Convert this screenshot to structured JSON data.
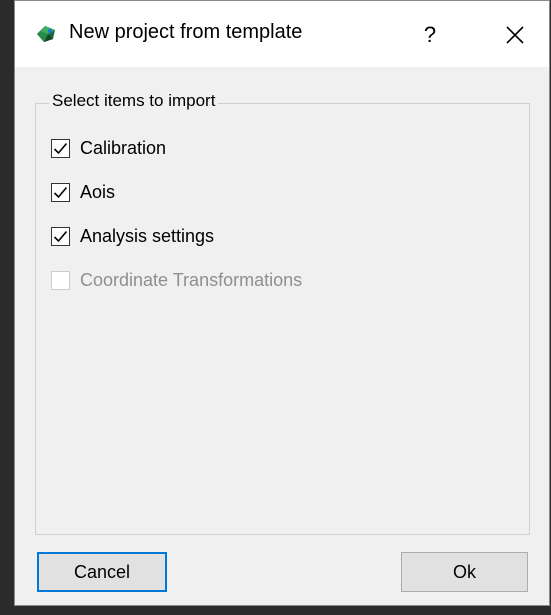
{
  "window": {
    "title": "New project from template",
    "help_label": "?",
    "close_icon": "close-icon",
    "app_icon": "app-logo-icon"
  },
  "group": {
    "title": "Select items to import",
    "items": [
      {
        "label": "Calibration",
        "checked": true,
        "enabled": true
      },
      {
        "label": "Aois",
        "checked": true,
        "enabled": true
      },
      {
        "label": "Analysis settings",
        "checked": true,
        "enabled": true
      },
      {
        "label": "Coordinate Transformations",
        "checked": false,
        "enabled": false
      }
    ]
  },
  "buttons": {
    "cancel_label": "Cancel",
    "ok_label": "Ok"
  },
  "colors": {
    "accent": "#0078d7",
    "window_bg": "#f0f0f0",
    "titlebar_bg": "#ffffff",
    "disabled_text": "#8f8f8f"
  }
}
